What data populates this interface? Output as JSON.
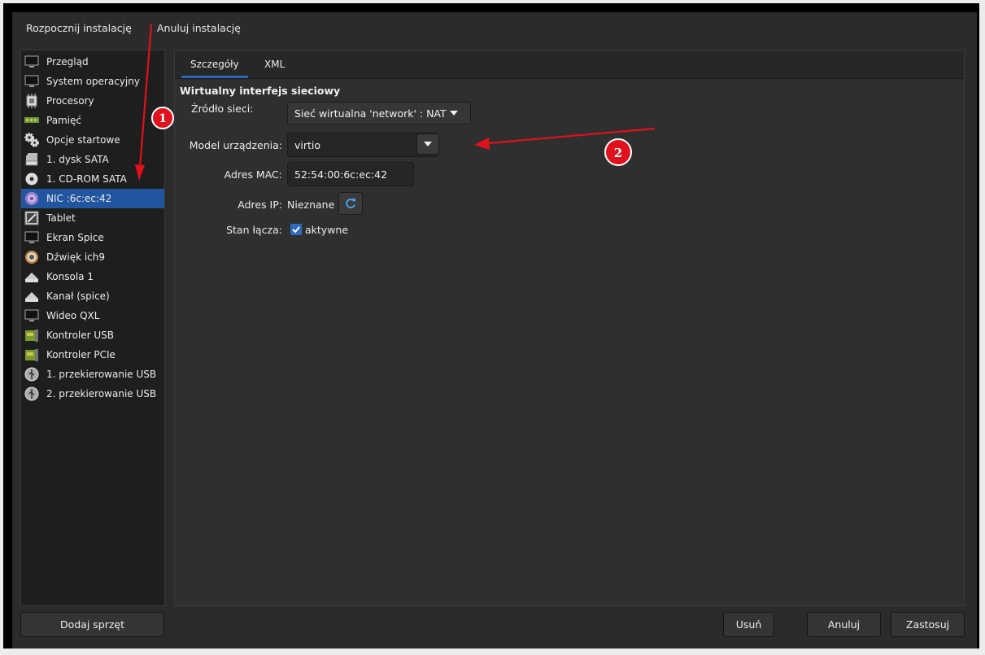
{
  "menu": {
    "start_install": "Rozpocznij instalację",
    "cancel_install": "Anuluj instalację"
  },
  "sidebar": {
    "items": [
      {
        "label": "Przegląd",
        "icon": "monitor-icon"
      },
      {
        "label": "System operacyjny",
        "icon": "monitor-icon"
      },
      {
        "label": "Procesory",
        "icon": "cpu-icon"
      },
      {
        "label": "Pamięć",
        "icon": "memory-icon"
      },
      {
        "label": "Opcje startowe",
        "icon": "gears-icon"
      },
      {
        "label": "1. dysk SATA",
        "icon": "disk-icon"
      },
      {
        "label": "1. CD-ROM SATA",
        "icon": "cdrom-icon"
      },
      {
        "label": "NIC :6c:ec:42",
        "icon": "nic-icon",
        "selected": true
      },
      {
        "label": "Tablet",
        "icon": "tablet-icon"
      },
      {
        "label": "Ekran Spice",
        "icon": "monitor-icon"
      },
      {
        "label": "Dźwięk ich9",
        "icon": "speaker-icon"
      },
      {
        "label": "Konsola 1",
        "icon": "serial-icon"
      },
      {
        "label": "Kanał (spice)",
        "icon": "serial-icon"
      },
      {
        "label": "Wideo QXL",
        "icon": "monitor-icon"
      },
      {
        "label": "Kontroler USB",
        "icon": "controller-icon"
      },
      {
        "label": "Kontroler PCIe",
        "icon": "controller-icon"
      },
      {
        "label": "1. przekierowanie USB",
        "icon": "usb-icon"
      },
      {
        "label": "2. przekierowanie USB",
        "icon": "usb-icon"
      }
    ],
    "add_hardware": "Dodaj sprzęt"
  },
  "tabs": {
    "details": "Szczegóły",
    "xml": "XML"
  },
  "nic": {
    "title": "Wirtualny interfejs sieciowy",
    "network_source_label": "Źródło sieci:",
    "network_source_value": "Sieć wirtualna 'network' : NAT",
    "device_model_label": "Model urządzenia:",
    "device_model_value": "virtio",
    "mac_label": "Adres MAC:",
    "mac_value": "52:54:00:6c:ec:42",
    "ip_label": "Adres IP:",
    "ip_value": "Nieznane",
    "link_state_label": "Stan łącza:",
    "link_state_value": "aktywne",
    "link_active": true
  },
  "buttons": {
    "remove": "Usuń",
    "cancel": "Anuluj",
    "apply": "Zastosuj"
  },
  "annotations": {
    "marker_1": "1",
    "marker_2": "2"
  },
  "colors": {
    "selection": "#2155a0",
    "accent": "#2f6ac0",
    "annotation": "#e0111b"
  }
}
